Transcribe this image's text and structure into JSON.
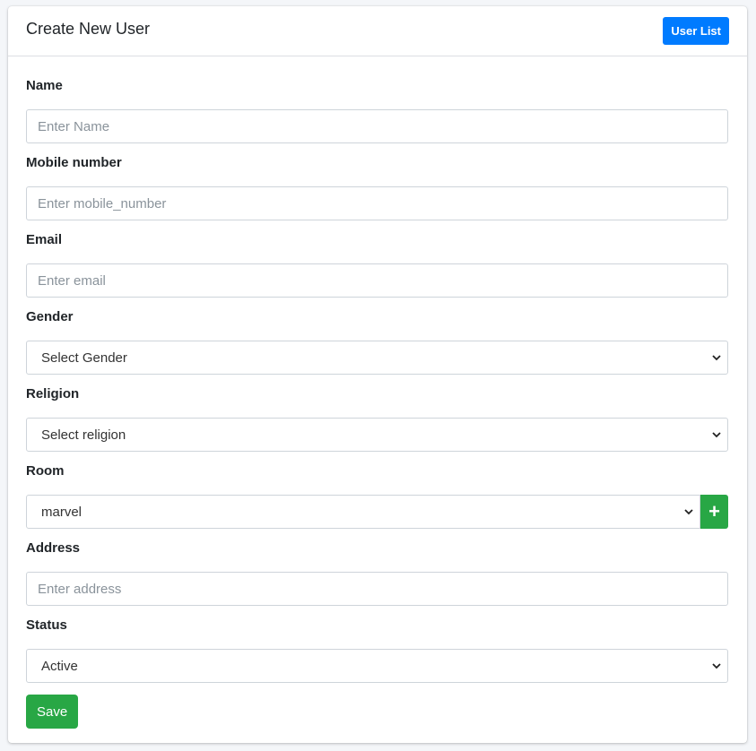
{
  "header": {
    "title": "Create New User",
    "user_list_label": "User List"
  },
  "form": {
    "name": {
      "label": "Name",
      "placeholder": "Enter Name",
      "value": ""
    },
    "mobile": {
      "label": "Mobile number",
      "placeholder": "Enter mobile_number",
      "value": ""
    },
    "email": {
      "label": "Email",
      "placeholder": "Enter email",
      "value": ""
    },
    "gender": {
      "label": "Gender",
      "selected": "Select Gender"
    },
    "religion": {
      "label": "Religion",
      "selected": "Select religion"
    },
    "room": {
      "label": "Room",
      "selected": "marvel",
      "add_label": "+"
    },
    "address": {
      "label": "Address",
      "placeholder": "Enter address",
      "value": ""
    },
    "status": {
      "label": "Status",
      "selected": "Active"
    },
    "save_label": "Save"
  },
  "colors": {
    "primary": "#007bff",
    "success": "#28a745",
    "border": "#ced4da"
  },
  "icons": {
    "select_arrow": "chevron-down-icon",
    "add_room": "plus-icon"
  }
}
